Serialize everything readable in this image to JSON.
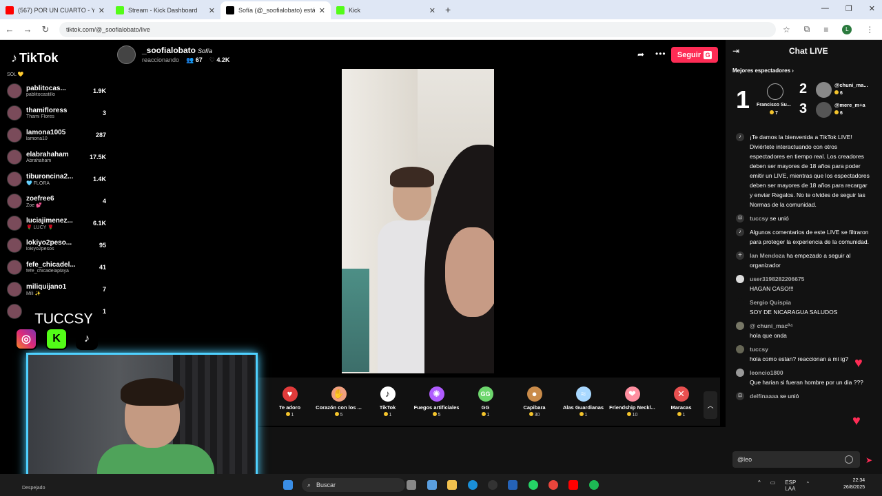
{
  "browser": {
    "tabs": [
      {
        "title": "(567) POR UN CUARTO - YouTube",
        "color": "#ff0000",
        "active": false
      },
      {
        "title": "Stream - Kick Dashboard",
        "color": "#53fc18",
        "active": false
      },
      {
        "title": "Sofía (@_soofialobato) está",
        "color": "#000000",
        "active": true
      },
      {
        "title": "Kick",
        "color": "#53fc18",
        "active": false
      }
    ],
    "url": "tiktok.com/@_soofialobato/live",
    "profile_initial": "L"
  },
  "tiktok": {
    "logo": "TikTok",
    "streamer": {
      "handle": "_soofialobato",
      "name": "Sofía",
      "status": "reaccionando",
      "viewers": "67",
      "likes": "4.2K"
    },
    "follow_label": "Seguir",
    "follow_badge": "G",
    "ranking": [
      {
        "name": "SOL 💛",
        "handle": "",
        "score": ""
      },
      {
        "name": "pablitocas...",
        "handle": "pablitocastillo",
        "score": "1.9K"
      },
      {
        "name": "thamifloress",
        "handle": "Thami Flores",
        "score": "3"
      },
      {
        "name": "lamona1005",
        "handle": "lamona10",
        "score": "287"
      },
      {
        "name": "elabrahaham",
        "handle": "Abrahaham",
        "score": "17.5K"
      },
      {
        "name": "tiburoncina2...",
        "handle": "🩵 FLORA",
        "score": "1.4K"
      },
      {
        "name": "zoefree6",
        "handle": "Zoe 💕",
        "score": "4"
      },
      {
        "name": "luciajimenez...",
        "handle": "🌹 LUCY 🌹",
        "score": "6.1K"
      },
      {
        "name": "lokiyo2peso...",
        "handle": "lokiyo2pesos",
        "score": "95"
      },
      {
        "name": "fefe_chicadel...",
        "handle": "fefe_chicadelaplaya",
        "score": "41"
      },
      {
        "name": "miliquijano1",
        "handle": "Mili ✨",
        "score": "7"
      },
      {
        "name": "",
        "handle": "",
        "score": "1"
      }
    ],
    "gifts": [
      {
        "label": "Te adoro",
        "price": "1",
        "color": "#e23b3b",
        "icon": "heart-chocolate-icon"
      },
      {
        "label": "Corazón con los ...",
        "price": "5",
        "color": "#f0a080",
        "icon": "hand-heart-icon"
      },
      {
        "label": "TikTok",
        "price": "1",
        "color": "#ffffff",
        "icon": "tiktok-icon"
      },
      {
        "label": "Fuegos artificiales",
        "price": "5",
        "color": "#b05cff",
        "icon": "fireworks-icon"
      },
      {
        "label": "GG",
        "price": "1",
        "color": "#6dd66d",
        "icon": "gg-icon"
      },
      {
        "label": "Capibara",
        "price": "30",
        "color": "#c98b4a",
        "icon": "capybara-icon"
      },
      {
        "label": "Alas Guardianas",
        "price": "1",
        "color": "#a8d8ff",
        "icon": "wings-icon"
      },
      {
        "label": "Friendship Neckl...",
        "price": "10",
        "color": "#ff8fa0",
        "icon": "necklace-icon"
      },
      {
        "label": "Maracas",
        "price": "1",
        "color": "#e85050",
        "icon": "maracas-icon"
      }
    ]
  },
  "overlay": {
    "brand": "TUCCSY"
  },
  "chat": {
    "title": "Chat LIVE",
    "best_label": "Mejores espectadores",
    "podium": [
      {
        "rank": "1",
        "name": "Francisco Su...",
        "coins": "7"
      },
      {
        "rank": "2",
        "name": "@chuni_ma...",
        "coins": "6"
      },
      {
        "rank": "3",
        "name": "@mere_m+a",
        "coins": "6"
      }
    ],
    "messages": [
      {
        "user": "",
        "text": "¡Te damos la bienvenida a TikTok LIVE! Diviértete interactuando con otros espectadores en tiempo real. Los creadores deben ser mayores de 18 años para poder emitir un LIVE, mientras que los espectadores deben ser mayores de 18 años para recargar y enviar Regalos. No te olvides de seguir las Normas de la comunidad."
      },
      {
        "user": "tuccsy",
        "text": "se unió"
      },
      {
        "user": "",
        "text": "Algunos comentarios de este LIVE se filtraron para proteger la experiencia de la comunidad."
      },
      {
        "user": "Ian Mendoza",
        "text": "ha empezado a seguir al organizador"
      },
      {
        "user": "user3198282206675",
        "text": "HAGAN CASO!!!"
      },
      {
        "user": "Sergio Quispia",
        "text": "SOY DE NICARAGUA SALUDOS"
      },
      {
        "user": "@ chuni_mac⁰⁴",
        "text": "hola que onda"
      },
      {
        "user": "tuccsy",
        "text": "hola como estan? reaccionan a mi ig?"
      },
      {
        "user": "leoncio1800",
        "text": "Que harian si fueran hombre por un dia ???"
      },
      {
        "user": "delfinaaaa",
        "text": "se unió"
      }
    ],
    "input_value": "@leo"
  },
  "taskbar": {
    "search": "Buscar",
    "weather": "Despejado",
    "lang": "ESP",
    "lang2": "LAA",
    "time": "22:34",
    "date": "26/8/2025"
  }
}
